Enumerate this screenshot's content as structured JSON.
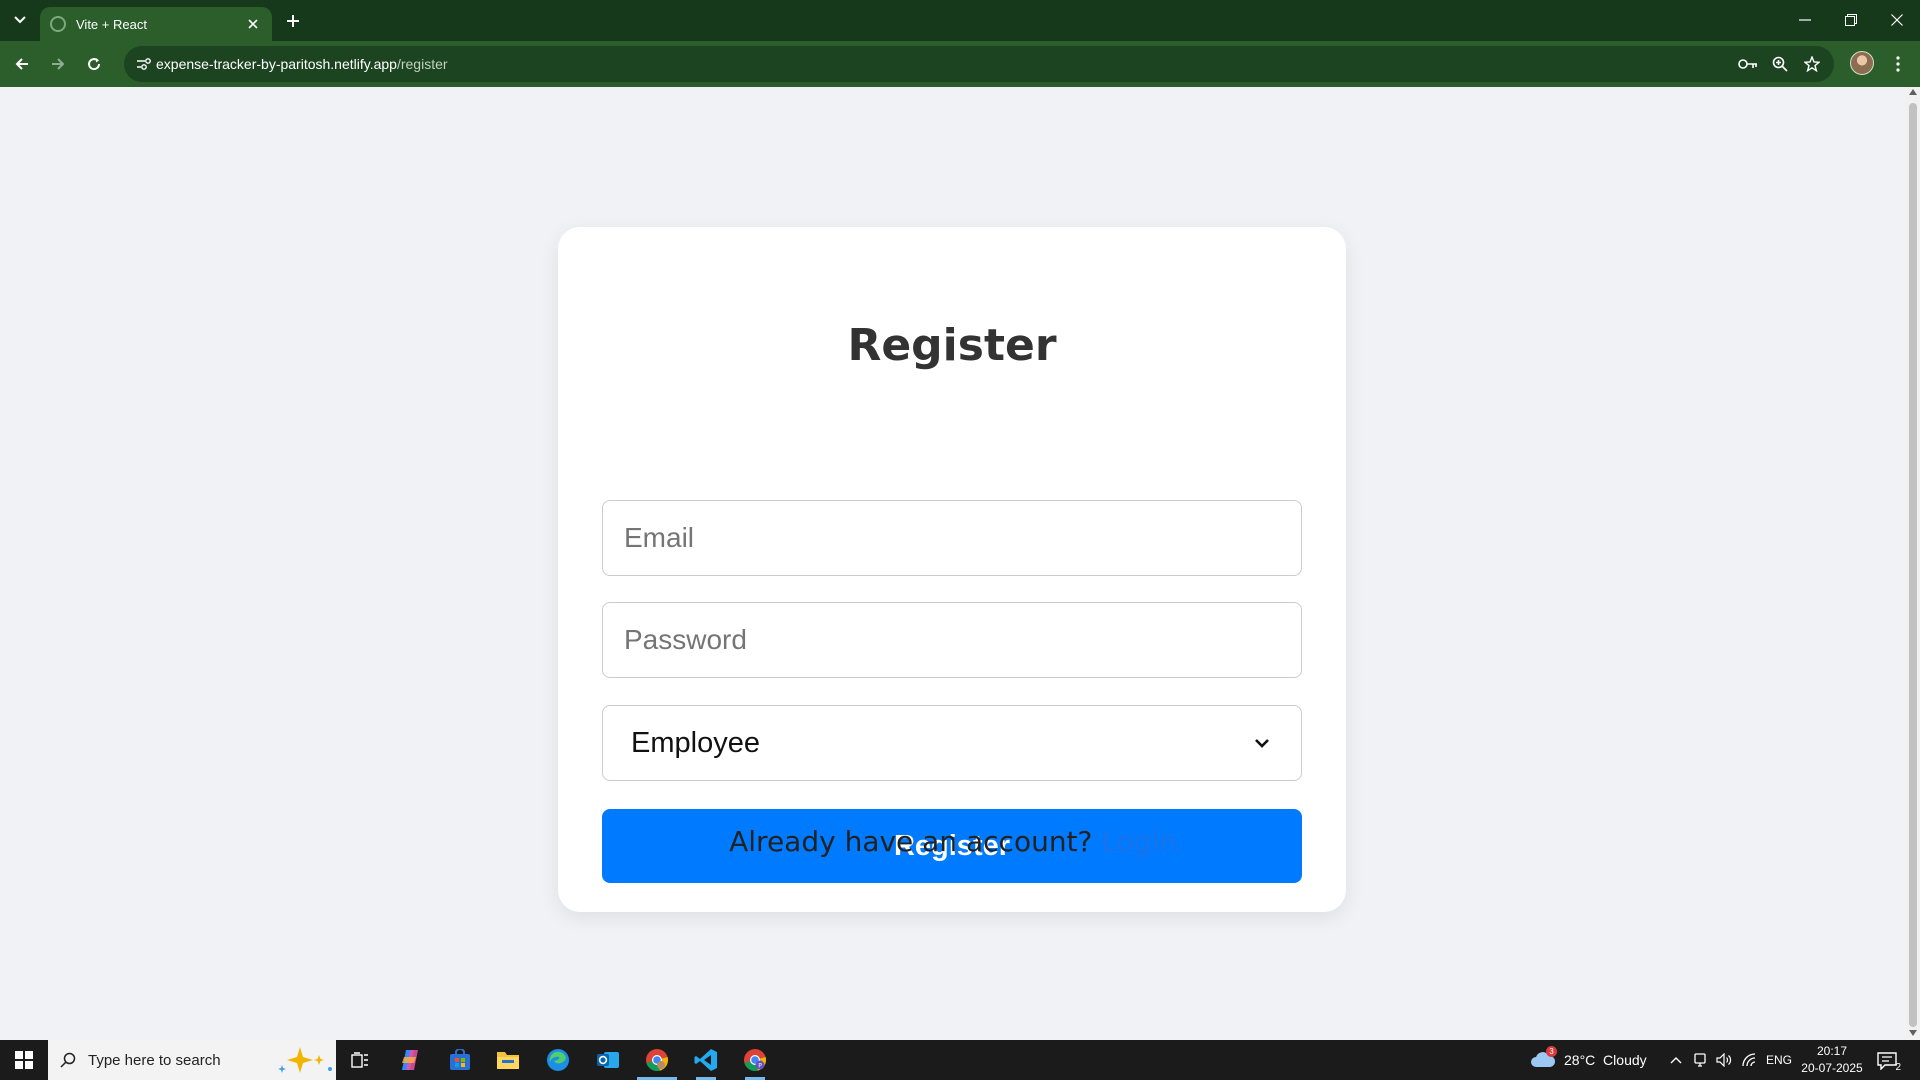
{
  "browser": {
    "tab_title": "Vite + React",
    "url_host": "expense-tracker-by-paritosh.netlify.app",
    "url_path": "/register"
  },
  "page": {
    "title": "Register",
    "email_placeholder": "Email",
    "password_placeholder": "Password",
    "role_selected": "Employee",
    "submit_label": "Register",
    "login_prompt": "Already have an account?",
    "login_link": "Login"
  },
  "taskbar": {
    "search_placeholder": "Type here to search",
    "weather_badge": "3",
    "weather": "28°C  Cloudy",
    "language": "ENG",
    "time": "20:17",
    "date": "20-07-2025",
    "notification_count": "2"
  },
  "colors": {
    "tabstrip": "#16381b",
    "toolbar": "#2b5e2b",
    "page_bg": "#f0f2f5",
    "primary_button": "#007bff",
    "link": "#1a73e8"
  },
  "icons": [
    "tab-search-icon",
    "favicon-icon",
    "close-icon",
    "plus-icon",
    "minimize-icon",
    "restore-icon",
    "back-icon",
    "forward-icon",
    "reload-icon",
    "site-info-icon",
    "password-key-icon",
    "zoom-icon",
    "star-icon",
    "kebab-menu-icon",
    "chevron-down-icon",
    "windows-start-icon",
    "search-icon",
    "task-view-icon",
    "copilot-icon",
    "store-icon",
    "file-explorer-icon",
    "edge-icon",
    "outlook-icon",
    "chrome-icon",
    "vscode-icon",
    "cloud-icon",
    "caret-up-icon",
    "meet-icon",
    "volume-icon",
    "wifi-icon",
    "notification-icon"
  ]
}
